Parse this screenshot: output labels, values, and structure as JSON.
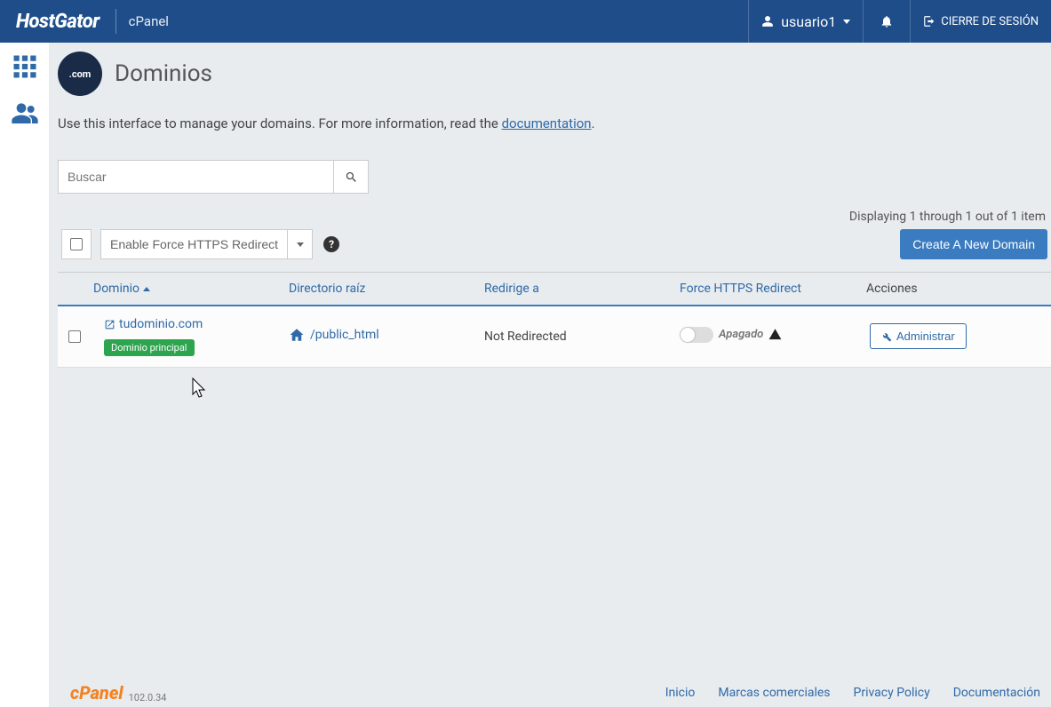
{
  "header": {
    "logo": "HostGator",
    "subbrand": "cPanel",
    "user": "usuario1",
    "logout": "CIERRE DE SESIÓN"
  },
  "page": {
    "icon_text": ".com",
    "title": "Dominios",
    "desc_pre": "Use this interface to manage your domains. For more information, read the ",
    "desc_link": "documentation",
    "desc_post": "."
  },
  "search": {
    "placeholder": "Buscar"
  },
  "pagination": "Displaying 1 through 1 out of 1 item",
  "toolbar": {
    "force_https": "Enable Force HTTPS Redirect",
    "create": "Create A New Domain"
  },
  "columns": {
    "domain": "Dominio",
    "root": "Directorio raíz",
    "redirect": "Redirige a",
    "https": "Force HTTPS Redirect",
    "actions": "Acciones"
  },
  "rows": [
    {
      "domain": "tudominio.com",
      "badge": "Dominio principal",
      "root": "/public_html",
      "redirect": "Not Redirected",
      "https_state": "Apagado",
      "manage": "Administrar"
    }
  ],
  "footer": {
    "brand": "cPanel",
    "version": "102.0.34",
    "links": {
      "home": "Inicio",
      "trademarks": "Marcas comerciales",
      "privacy": "Privacy Policy",
      "docs": "Documentación"
    }
  }
}
